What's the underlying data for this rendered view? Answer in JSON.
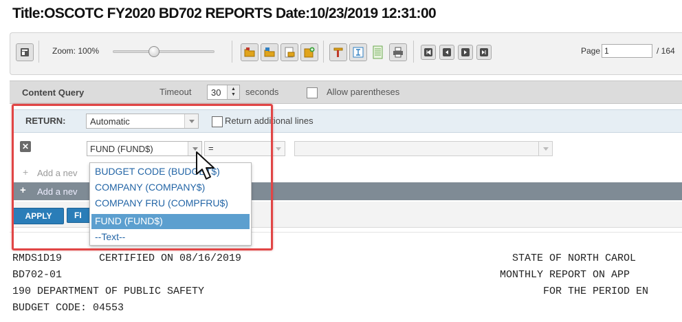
{
  "title": "Title:OSCOTC FY2020 BD702 REPORTS Date:10/23/2019 12:31:00",
  "toolbar": {
    "zoom_label": "Zoom: 100%",
    "page_label": "Page",
    "page_value": "1",
    "page_total": "/ 164",
    "icons": [
      "sidebar-toggle-icon",
      "folder-icon",
      "folder-search-icon",
      "export-icon",
      "add-icon",
      "highlight-icon",
      "text-select-icon",
      "page-icon",
      "print-icon",
      "first-page-icon",
      "prev-page-icon",
      "next-page-icon",
      "last-page-icon"
    ]
  },
  "query": {
    "content_query_label": "Content Query",
    "timeout_label": "Timeout",
    "timeout_value": "30",
    "seconds_label": "seconds",
    "allow_parentheses_label": "Allow parentheses",
    "return_label": "RETURN:",
    "return_value": "Automatic",
    "return_additional_label": "Return additional lines",
    "filter": {
      "field_value": "FUND (FUND$)",
      "operator_value": "=",
      "value": ""
    },
    "add_new_1": "Add a nev",
    "add_new_2": "Add a nev",
    "apply_label": "APPLY",
    "filter_button_label": "FI"
  },
  "dropdown": {
    "options": [
      "BUDGET CODE (BUDGET$)",
      "COMPANY (COMPANY$)",
      "COMPANY FRU (COMPFRU$)",
      "FUND (FUND$)",
      "--Text--"
    ],
    "selected_index": 3
  },
  "report": {
    "lines": [
      "RMDS1D19      CERTIFIED ON 08/16/2019",
      "BD702-01",
      "190 DEPARTMENT OF PUBLIC SAFETY",
      "BUDGET CODE: 04553"
    ],
    "right_lines": [
      "STATE OF NORTH CAROL",
      "MONTHLY REPORT ON APP",
      "FOR THE PERIOD EN"
    ]
  },
  "colors": {
    "accent": "#2a7db8",
    "highlight": "#e14545",
    "selected_option": "#5c9fcf",
    "option_text": "#2365a6"
  }
}
